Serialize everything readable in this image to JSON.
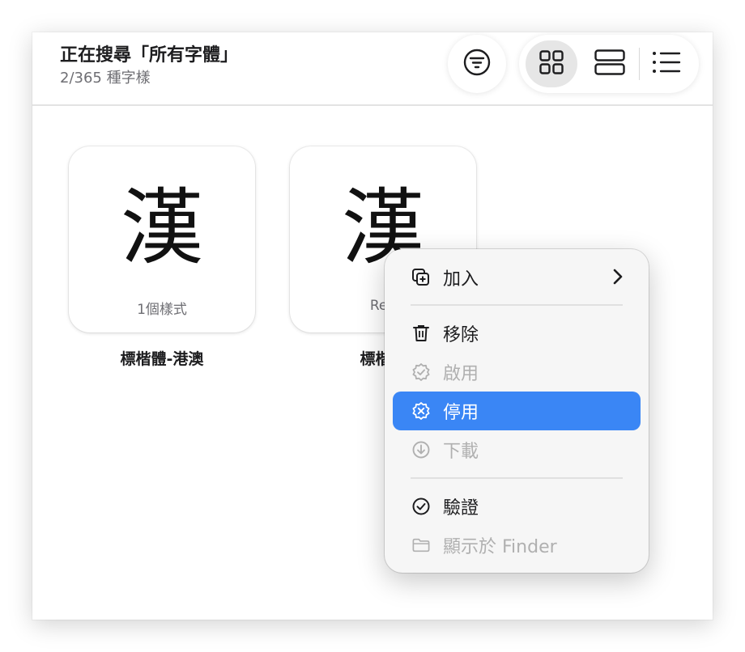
{
  "header": {
    "title": "正在搜尋「所有字體」",
    "subtitle": "2/365 種字樣"
  },
  "toolbar": {
    "filter_icon": "filter-icon",
    "views": [
      {
        "name": "grid-view",
        "icon": "grid-icon",
        "active": true
      },
      {
        "name": "sample-view",
        "icon": "rows-icon",
        "active": false
      },
      {
        "name": "list-view",
        "icon": "list-icon",
        "active": false
      }
    ]
  },
  "fonts": [
    {
      "glyph": "漢",
      "styles": "1個樣式",
      "name": "標楷體-港澳"
    },
    {
      "glyph": "漢",
      "styles": "Reg",
      "name": "標楷體"
    }
  ],
  "context_menu": {
    "items": [
      {
        "label": "加入",
        "icon": "add-to-collection-icon",
        "state": "enabled",
        "submenu": true
      },
      {
        "label": "移除",
        "icon": "trash-icon",
        "state": "enabled"
      },
      {
        "label": "啟用",
        "icon": "activate-badge-icon",
        "state": "disabled"
      },
      {
        "label": "停用",
        "icon": "deactivate-badge-icon",
        "state": "selected"
      },
      {
        "label": "下載",
        "icon": "download-icon",
        "state": "disabled"
      },
      {
        "label": "驗證",
        "icon": "validate-check-icon",
        "state": "enabled"
      },
      {
        "label": "顯示於 Finder",
        "icon": "folder-icon",
        "state": "disabled"
      }
    ]
  },
  "colors": {
    "accent": "#3a86f5",
    "text": "#1d1d1f",
    "secondary_text": "#6e6e73",
    "disabled_text": "#b0b0b0"
  }
}
